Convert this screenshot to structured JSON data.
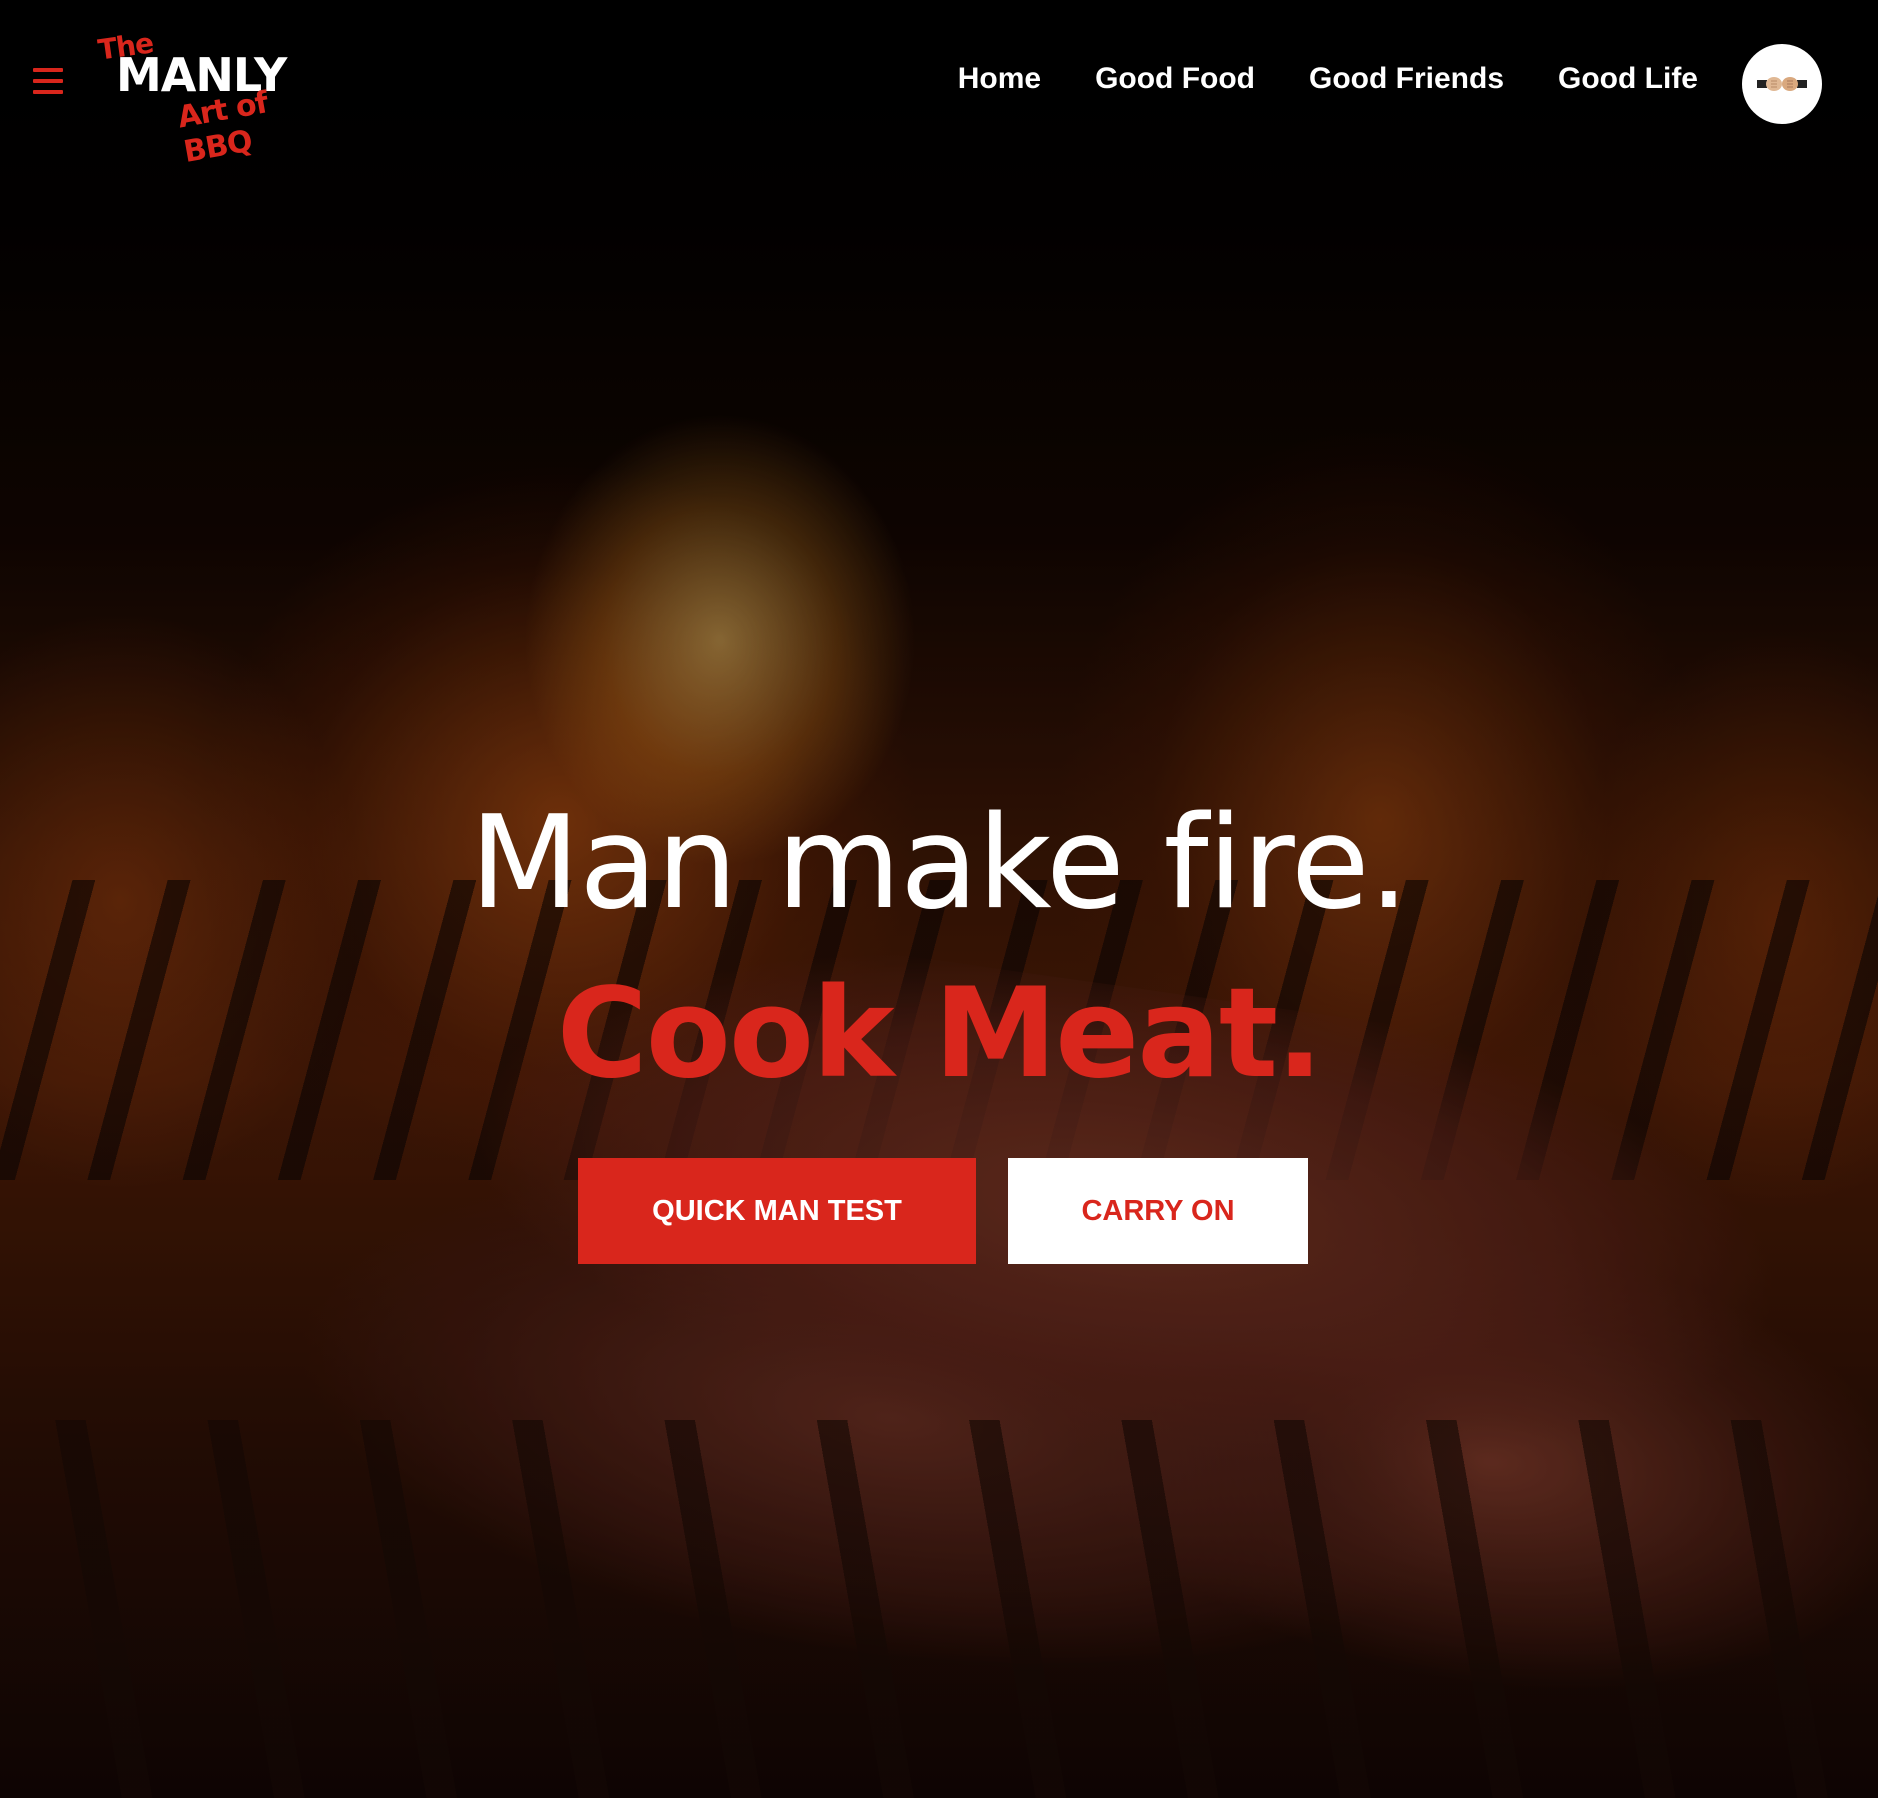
{
  "logo": {
    "line1": "The",
    "line2": "MANLY",
    "line3": "Art of BBQ"
  },
  "nav": {
    "items": [
      {
        "label": "Home"
      },
      {
        "label": "Good Food"
      },
      {
        "label": "Good Friends"
      },
      {
        "label": "Good Life"
      }
    ]
  },
  "hero": {
    "headline": "Man make fire.",
    "subheadline": "Cook Meat.",
    "primary_button": "QUICK MAN TEST",
    "secondary_button": "CARRY ON"
  },
  "colors": {
    "accent": "#d9261c",
    "text_light": "#ffffff",
    "background": "#000000"
  },
  "icons": {
    "menu": "hamburger-menu-icon",
    "avatar": "fist-bump-avatar"
  }
}
